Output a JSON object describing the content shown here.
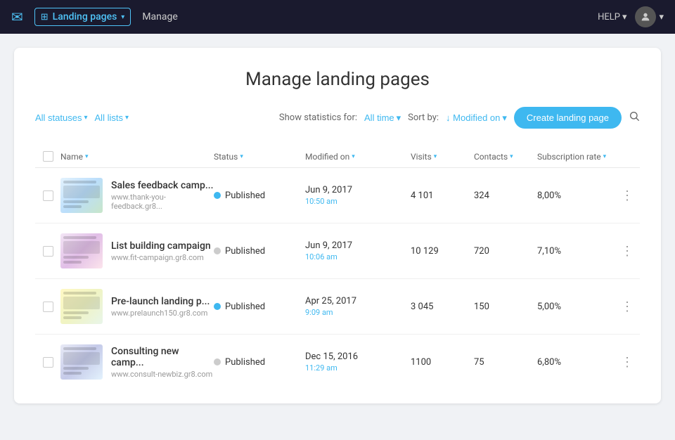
{
  "topnav": {
    "mail_icon": "✉",
    "brand_label": "Landing pages",
    "brand_chevron": "▾",
    "manage_label": "Manage",
    "help_label": "HELP",
    "help_chevron": "▾",
    "avatar_icon": "👤",
    "avatar_chevron": "▾"
  },
  "page": {
    "title": "Manage landing pages"
  },
  "filters": {
    "all_statuses_label": "All statuses",
    "all_statuses_chevron": "▾",
    "all_lists_label": "All lists",
    "all_lists_chevron": "▾",
    "show_stats_label": "Show statistics for:",
    "all_time_label": "All time",
    "all_time_chevron": "▾",
    "sort_by_label": "Sort by:",
    "sort_by_value": "↓ Modified on",
    "sort_by_chevron": "▾",
    "create_btn_label": "Create landing page",
    "search_icon": "🔍"
  },
  "table": {
    "columns": {
      "checkbox": "",
      "name": "Name",
      "name_sort": "▾",
      "status": "Status",
      "status_sort": "▾",
      "modified_on": "Modified on",
      "modified_sort": "▾",
      "visits": "Visits",
      "visits_sort": "▾",
      "contacts": "Contacts",
      "contacts_sort": "▾",
      "subscription_rate": "Subscription rate",
      "subscription_sort": "▾"
    },
    "rows": [
      {
        "id": 1,
        "name": "Sales feedback camp...",
        "url": "www.thank-you-feedback.gr8...",
        "status": "Published",
        "status_active": true,
        "date": "Jun 9, 2017",
        "time": "10:50 am",
        "visits": "4 101",
        "contacts": "324",
        "subscription_rate": "8,00%",
        "thumb_class": "thumb-sales"
      },
      {
        "id": 2,
        "name": "List building campaign",
        "url": "www.fit-campaign.gr8.com",
        "status": "Published",
        "status_active": false,
        "date": "Jun 9, 2017",
        "time": "10:06 am",
        "visits": "10 129",
        "contacts": "720",
        "subscription_rate": "7,10%",
        "thumb_class": "thumb-list"
      },
      {
        "id": 3,
        "name": "Pre-launch landing p...",
        "url": "www.prelaunch150.gr8.com",
        "status": "Published",
        "status_active": true,
        "date": "Apr 25, 2017",
        "time": "9:09 am",
        "visits": "3 045",
        "contacts": "150",
        "subscription_rate": "5,00%",
        "thumb_class": "thumb-prelaunch"
      },
      {
        "id": 4,
        "name": "Consulting new camp...",
        "url": "www.consult-newbiz.gr8.com",
        "status": "Published",
        "status_active": false,
        "date": "Dec 15, 2016",
        "time": "11:29 am",
        "visits": "1100",
        "contacts": "75",
        "subscription_rate": "6,80%",
        "thumb_class": "thumb-consulting"
      }
    ]
  }
}
